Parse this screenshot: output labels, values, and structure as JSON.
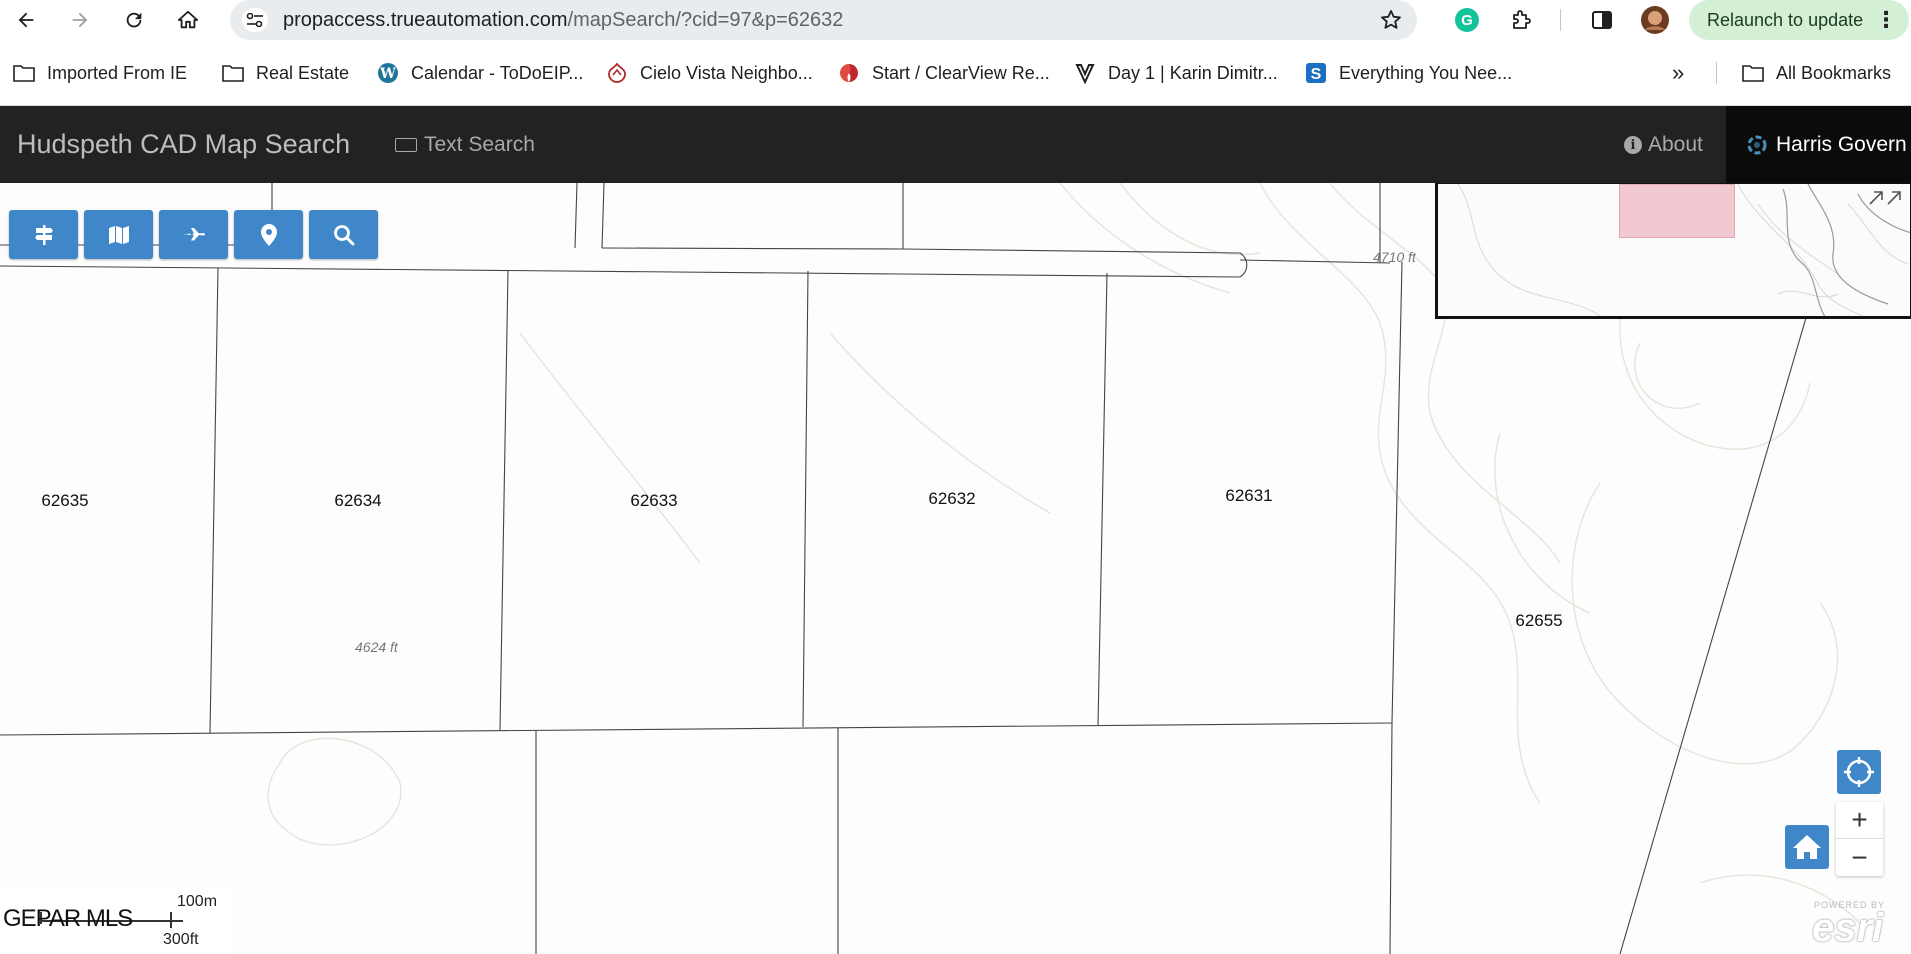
{
  "browser": {
    "url_host": "propaccess.trueautomation.com",
    "url_path": "/mapSearch/?cid=97&p=62632",
    "relaunch_label": "Relaunch to update",
    "bookmarks": [
      {
        "label": "Imported From IE",
        "icon": "folder-icon"
      },
      {
        "label": "Real Estate",
        "icon": "folder-icon"
      },
      {
        "label": "Calendar - ToDoEIP...",
        "icon": "wordpress-icon"
      },
      {
        "label": "Cielo Vista Neighbo...",
        "icon": "cielo-vista-icon"
      },
      {
        "label": "Start / ClearView Re...",
        "icon": "clearview-icon"
      },
      {
        "label": "Day 1 | Karin Dimitr...",
        "icon": "v-logo-icon"
      },
      {
        "label": "Everything You Nee...",
        "icon": "s-logo-icon"
      }
    ],
    "overflow_label": "»",
    "all_bookmarks_label": "All Bookmarks"
  },
  "app": {
    "title": "Hudspeth CAD Map Search",
    "text_search_label": "Text Search",
    "about_label": "About",
    "brand_label": "Harris Govern"
  },
  "map": {
    "parcels": [
      {
        "id": "62635"
      },
      {
        "id": "62634"
      },
      {
        "id": "62633"
      },
      {
        "id": "62632"
      },
      {
        "id": "62631"
      },
      {
        "id": "62655"
      }
    ],
    "elevations": [
      "4710 ft",
      "4624 ft"
    ],
    "scale_metric": "100m",
    "scale_imperial": "300ft",
    "watermark": "GEPAR MLS",
    "esri_powered": "POWERED BY",
    "esri_label": "esri",
    "tool_buttons": [
      "road-sign-icon",
      "map-icon",
      "airplane-icon",
      "map-marker-icon",
      "search-icon"
    ]
  },
  "colors": {
    "navbar": "#222222",
    "brand_block": "#0b0b0b",
    "tool_button": "#3f87c8",
    "relaunch_bg": "#d3f0d7",
    "overview_extent": "#f3c9d1"
  }
}
